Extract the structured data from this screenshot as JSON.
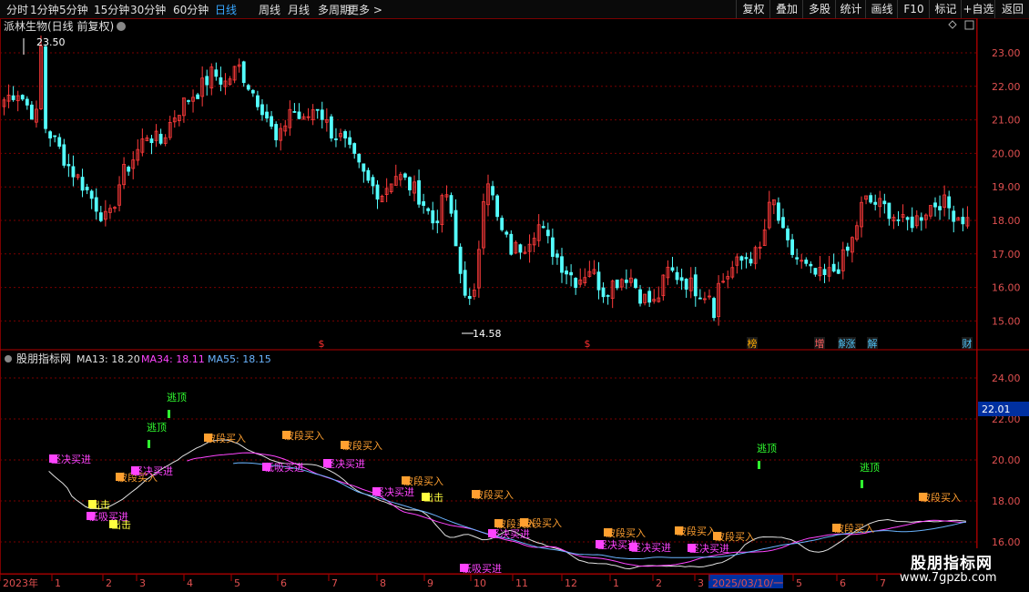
{
  "toolbar": {
    "periods": [
      "分时",
      "1分钟",
      "5分钟",
      "15分钟",
      "30分钟",
      "60分钟",
      "日线",
      "周线",
      "月线",
      "多周期",
      "更多 >"
    ],
    "active": "日线",
    "right_buttons": [
      "复权",
      "叠加",
      "多股",
      "统计",
      "画线",
      "F10",
      "标记",
      "+自选",
      "返回"
    ]
  },
  "price_panel": {
    "title": "派林生物(日线 前复权)",
    "high_label": "23.50",
    "low_label": "14.58",
    "yticks": [
      "23.00",
      "22.00",
      "21.00",
      "20.00",
      "19.00",
      "18.00",
      "17.00",
      "16.00",
      "15.00"
    ],
    "events": [
      {
        "label": "$",
        "color": "#ff3030"
      },
      {
        "label": "$",
        "color": "#ff3030"
      },
      {
        "label": "榜",
        "color": "#ffaa00"
      },
      {
        "label": "增",
        "color": "#ff6060"
      },
      {
        "label": "解",
        "color": "#4fc3f7"
      },
      {
        "label": "涨",
        "color": "#4fc3f7"
      },
      {
        "label": "解",
        "color": "#4fc3f7"
      },
      {
        "label": "财",
        "color": "#4fc3f7"
      }
    ],
    "colors": {
      "up": "#ff3b3b",
      "down": "#54ffff",
      "grid": "#7a0000"
    }
  },
  "indicator_panel": {
    "title": "股朋指标网",
    "ma13": {
      "label": "MA13: 18.20",
      "color": "#e0e0e0"
    },
    "ma34": {
      "label": "MA34: 18.11",
      "color": "#ff44ff"
    },
    "ma55": {
      "label": "MA55: 18.15",
      "color": "#6ab4ff"
    },
    "yticks": [
      "24.00",
      "22.00",
      "20.00",
      "18.00",
      "16.00"
    ],
    "current_value": "22.01",
    "signals": {
      "escape_top": "逃顶",
      "wave_buy": "波段买入",
      "decisive_buy": "坚决买进",
      "absorb_buy": "低吸买进",
      "attack": "出击"
    }
  },
  "time_axis": {
    "labels": [
      "2023年",
      "1",
      "2",
      "3",
      "4",
      "5",
      "6",
      "7",
      "8",
      "9",
      "10",
      "11",
      "12",
      "1",
      "2",
      "3",
      "2025/03/10/一",
      "5",
      "6",
      "7"
    ]
  },
  "watermark": {
    "line1": "股朋指标网",
    "line2": "www.7gpzb.com"
  },
  "chart_data": {
    "type": "candlestick",
    "ohlc_note": "daily bars, front-adjusted",
    "ylim": [
      14.3,
      23.8
    ],
    "key_points": [
      {
        "label": "high",
        "value": 23.5
      },
      {
        "label": "low",
        "value": 14.58
      }
    ],
    "close_path": [
      21.6,
      21.9,
      21.3,
      20.9,
      20.3,
      19.6,
      19.1,
      18.5,
      17.9,
      19.3,
      19.9,
      20.6,
      20.3,
      21.1,
      21.6,
      21.9,
      22.4,
      22.1,
      22.6,
      21.9,
      21.3,
      20.2,
      21.4,
      20.9,
      21.5,
      20.7,
      20.4,
      19.7,
      19.1,
      18.8,
      19.4,
      19.1,
      18.7,
      17.9,
      18.8,
      16.5,
      15.2,
      19.6,
      17.8,
      17.1,
      17.3,
      17.9,
      17.2,
      16.6,
      16.2,
      16.6,
      15.9,
      16.2,
      16.4,
      15.7,
      15.5,
      16.5,
      16.3,
      16.0,
      15.8,
      16.1,
      16.6,
      16.9,
      17.0,
      18.7,
      17.3,
      16.8,
      16.4,
      16.3,
      16.6,
      17.2,
      18.6,
      18.5,
      18.3,
      17.9,
      18.0,
      18.4,
      18.6,
      18.2,
      18.0
    ]
  }
}
